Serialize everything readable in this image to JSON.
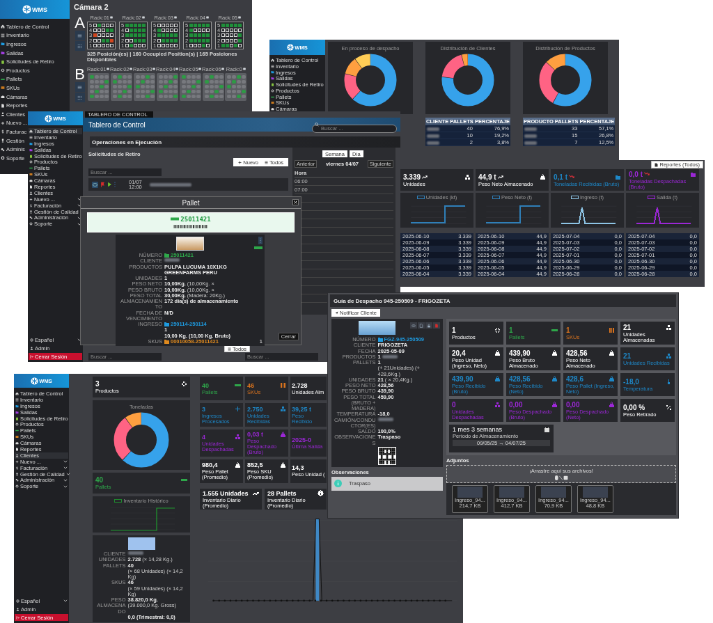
{
  "camera_window": {
    "sidebar": {
      "logo": "WMS",
      "items": [
        {
          "label": "Tablero de Control",
          "kind": "home",
          "selected": false
        },
        {
          "label": "Inventario",
          "kind": "list",
          "selected": false
        },
        {
          "label": "Ingresos",
          "kind": "inbox",
          "selected": false
        },
        {
          "label": "Salidas",
          "kind": "outbox",
          "selected": false
        },
        {
          "label": "Solicitudes de Retiro",
          "kind": "clipboard",
          "selected": false
        },
        {
          "label": "Productos",
          "kind": "gear",
          "selected": false
        },
        {
          "label": "Pallets",
          "kind": "pallet",
          "selected": false
        },
        {
          "label": "SKUs",
          "kind": "box",
          "selected": false
        },
        {
          "label": "Cámaras",
          "kind": "building",
          "selected": false
        },
        {
          "label": "Reportes",
          "kind": "doc",
          "selected": false
        },
        {
          "label": "Clientes",
          "kind": "person",
          "selected": false
        },
        {
          "label": "Nuevo ...",
          "kind": "plus",
          "selected": false
        },
        {
          "label": "Facturac",
          "kind": "dollar",
          "selected": false
        },
        {
          "label": "Gestión",
          "kind": "trophy",
          "selected": false
        },
        {
          "label": "Adminis",
          "kind": "gears",
          "selected": false
        },
        {
          "label": "Soporte",
          "kind": "help",
          "selected": false
        }
      ]
    },
    "title": "Cámara 2",
    "sections": [
      {
        "letter": "A",
        "racks": [
          {
            "label": "Rack:01",
            "rows": [
              {
                "number": "5",
                "cells": [
                  {
                    "kind": "free"
                  },
                  {
                    "kind": "full"
                  },
                  {
                    "kind": "free"
                  },
                  {
                    "kind": "free"
                  },
                  {
                    "kind": "free"
                  }
                ]
              },
              {
                "number": "4",
                "cells": [
                  {
                    "kind": "free"
                  },
                  {
                    "kind": "free"
                  },
                  {
                    "kind": "free"
                  },
                  {
                    "kind": "full"
                  },
                  {
                    "kind": "full"
                  }
                ]
              },
              {
                "number": "3",
                "cells": [
                  {
                    "kind": "alert"
                  },
                  {
                    "kind": "free"
                  },
                  {
                    "kind": "free"
                  },
                  {
                    "kind": "free"
                  },
                  {
                    "kind": "free"
                  }
                ]
              },
              {
                "number": "2",
                "cells": [
                  {
                    "kind": "free"
                  },
                  {
                    "kind": "free"
                  },
                  {
                    "kind": "full"
                  },
                  {
                    "kind": "full"
                  },
                  {
                    "kind": "alert"
                  }
                ]
              },
              {
                "number": "1",
                "cells": [
                  {
                    "kind": "free"
                  },
                  {
                    "kind": "free"
                  },
                  {
                    "kind": "free"
                  },
                  {
                    "kind": "free"
                  },
                  {
                    "kind": "free"
                  }
                ]
              }
            ]
          },
          {
            "label": "Rack:02",
            "rows": [
              {
                "number": "5",
                "cells": [
                  {
                    "kind": "full"
                  },
                  {
                    "kind": "full"
                  },
                  {
                    "kind": "full"
                  },
                  {
                    "kind": "full"
                  },
                  {
                    "kind": "full"
                  }
                ]
              },
              {
                "number": "4",
                "cells": [
                  {
                    "kind": "free"
                  },
                  {
                    "kind": "full"
                  },
                  {
                    "kind": "full"
                  },
                  {
                    "kind": "full"
                  },
                  {
                    "kind": "full"
                  }
                ]
              },
              {
                "number": "3",
                "cells": [
                  {
                    "kind": "full"
                  },
                  {
                    "kind": "full"
                  },
                  {
                    "kind": "full"
                  },
                  {
                    "kind": "full"
                  },
                  {
                    "kind": "full"
                  }
                ]
              },
              {
                "number": "2",
                "cells": [
                  {
                    "kind": "free"
                  },
                  {
                    "kind": "free"
                  },
                  {
                    "kind": "full"
                  },
                  {
                    "kind": "full"
                  },
                  {
                    "kind": "full"
                  }
                ]
              },
              {
                "number": "1",
                "cells": [
                  {
                    "kind": "free"
                  },
                  {
                    "kind": "full"
                  },
                  {
                    "kind": "free"
                  },
                  {
                    "kind": "free"
                  },
                  {
                    "kind": "free"
                  }
                ]
              }
            ]
          },
          {
            "label": "Rack:03",
            "rows": [
              {
                "number": "5",
                "cells": [
                  {
                    "kind": "free"
                  },
                  {
                    "kind": "free"
                  },
                  {
                    "kind": "free"
                  },
                  {
                    "kind": "free"
                  },
                  {
                    "kind": "free"
                  }
                ]
              },
              {
                "number": "4",
                "cells": [
                  {
                    "kind": "full"
                  },
                  {
                    "kind": "free"
                  },
                  {
                    "kind": "free"
                  },
                  {
                    "kind": "free"
                  },
                  {
                    "kind": "free"
                  }
                ]
              },
              {
                "number": "3",
                "cells": [
                  {
                    "kind": "full"
                  },
                  {
                    "kind": "full"
                  },
                  {
                    "kind": "full"
                  },
                  {
                    "kind": "full"
                  },
                  {
                    "kind": "full"
                  }
                ]
              },
              {
                "number": "2",
                "cells": [
                  {
                    "kind": "free"
                  },
                  {
                    "kind": "full"
                  },
                  {
                    "kind": "full"
                  },
                  {
                    "kind": "full"
                  },
                  {
                    "kind": "full"
                  }
                ]
              },
              {
                "number": "1",
                "cells": [
                  {
                    "kind": "free"
                  },
                  {
                    "kind": "free"
                  },
                  {
                    "kind": "free"
                  },
                  {
                    "kind": "free"
                  },
                  {
                    "kind": "free"
                  }
                ]
              }
            ]
          },
          {
            "label": "Rack:04",
            "rows": [
              {
                "number": "5",
                "cells": [
                  {
                    "kind": "full"
                  },
                  {
                    "kind": "full"
                  },
                  {
                    "kind": "full"
                  },
                  {
                    "kind": "full"
                  },
                  {
                    "kind": "full"
                  }
                ]
              },
              {
                "number": "4",
                "cells": [
                  {
                    "kind": "full"
                  },
                  {
                    "kind": "free"
                  },
                  {
                    "kind": "free"
                  },
                  {
                    "kind": "free"
                  },
                  {
                    "kind": "free"
                  }
                ]
              },
              {
                "number": "3",
                "cells": [
                  {
                    "kind": "full"
                  },
                  {
                    "kind": "full"
                  },
                  {
                    "kind": "full"
                  },
                  {
                    "kind": "full"
                  },
                  {
                    "kind": "full"
                  }
                ]
              },
              {
                "number": "2",
                "cells": [
                  {
                    "kind": "full"
                  },
                  {
                    "kind": "full"
                  },
                  {
                    "kind": "full"
                  },
                  {
                    "kind": "full"
                  },
                  {
                    "kind": "full"
                  }
                ]
              },
              {
                "number": "1",
                "cells": [
                  {
                    "kind": "free"
                  },
                  {
                    "kind": "free"
                  },
                  {
                    "kind": "free"
                  },
                  {
                    "kind": "full"
                  },
                  {
                    "kind": "free"
                  }
                ]
              }
            ]
          },
          {
            "label": "Rack:05",
            "rows": [
              {
                "number": "5",
                "cells": [
                  {
                    "kind": "full"
                  },
                  {
                    "kind": "full"
                  },
                  {
                    "kind": "full"
                  },
                  {
                    "kind": "full"
                  },
                  {
                    "kind": "full"
                  }
                ]
              },
              {
                "number": "4",
                "cells": [
                  {
                    "kind": "free"
                  },
                  {
                    "kind": "free"
                  },
                  {
                    "kind": "free"
                  },
                  {
                    "kind": "free"
                  },
                  {
                    "kind": "free"
                  }
                ]
              },
              {
                "number": "3",
                "cells": [
                  {
                    "kind": "free"
                  },
                  {
                    "kind": "free"
                  },
                  {
                    "kind": "free"
                  },
                  {
                    "kind": "free"
                  },
                  {
                    "kind": "full"
                  }
                ]
              },
              {
                "number": "2",
                "cells": [
                  {
                    "kind": "free"
                  },
                  {
                    "kind": "free"
                  },
                  {
                    "kind": "free"
                  },
                  {
                    "kind": "free"
                  },
                  {
                    "kind": "full"
                  }
                ]
              },
              {
                "number": "1",
                "cells": [
                  {
                    "kind": "full"
                  },
                  {
                    "kind": "full"
                  },
                  {
                    "kind": "free"
                  },
                  {
                    "kind": "full"
                  },
                  {
                    "kind": "free"
                  }
                ]
              }
            ]
          }
        ],
        "summary": "325 Posición(es) | 160 Occupied Position(s) | 165 Posiciones Disponibles"
      },
      {
        "letter": "B",
        "racks": [
          {
            "label": "Rack:01"
          },
          {
            "label": "Rack:02"
          },
          {
            "label": "Rack:03"
          },
          {
            "label": "Rack:04"
          },
          {
            "label": "Rack:05"
          },
          {
            "label": "Rack:06"
          },
          {
            "label": "Rack:0"
          }
        ]
      }
    ]
  },
  "dashboard_window": {
    "sidebar": {
      "logo": "WMS",
      "items": [
        {
          "label": "Tablero de Control",
          "kind": "home",
          "selected": false
        },
        {
          "label": "Inventario",
          "kind": "list",
          "selected": false
        },
        {
          "label": "Ingresos",
          "kind": "inbox",
          "selected": false
        },
        {
          "label": "Salidas",
          "kind": "outbox",
          "selected": false
        },
        {
          "label": "Solicitudes de Retiro",
          "kind": "clipboard",
          "selected": false
        },
        {
          "label": "Productos",
          "kind": "gear",
          "selected": false
        },
        {
          "label": "Pallets",
          "kind": "pallet",
          "selected": false
        },
        {
          "label": "SKUs",
          "kind": "box",
          "selected": false
        },
        {
          "label": "Cámaras",
          "kind": "building",
          "selected": false
        }
      ]
    },
    "donut_cards": [
      {
        "title": "En proceso de despacho"
      },
      {
        "title": "Distribución de Clientes",
        "table": {
          "columns": [
            "CLIENTE",
            "PALLETS",
            "PERCENTAJE"
          ],
          "rows": [
            {
              "pallets": "40",
              "share": "76,9%"
            },
            {
              "pallets": "10",
              "share": "19,2%"
            },
            {
              "pallets": "2",
              "share": "3,8%"
            }
          ]
        }
      },
      {
        "title": "Distribución de Productos",
        "table": {
          "columns": [
            "PRODUCTO",
            "PALLETS",
            "PERCENTAJE"
          ],
          "rows": [
            {
              "pallets": "33",
              "share": "57,1%"
            },
            {
              "pallets": "15",
              "share": "26,8%"
            },
            {
              "pallets": "7",
              "share": "12,5%"
            }
          ]
        }
      }
    ],
    "reports_button": "Reportes (Todos)",
    "stats": [
      {
        "value": "3.339",
        "rising": true,
        "caption": "Unidades",
        "color": "#ffffff",
        "kind": "boxes"
      },
      {
        "value": "44,9 t",
        "rising": true,
        "caption": "Peso Neto Almacenado",
        "color": "#ffffff",
        "kind": "weight"
      },
      {
        "value": "0,1 t",
        "rising": false,
        "caption": "Toneladas Recibidas (Bruto)",
        "color": "#1e88c8",
        "kind": "inbox"
      },
      {
        "value": "0,0 t",
        "rising": false,
        "caption": "Toneladas Despachadas (Bruto)",
        "color": "#9b27d6",
        "kind": "outbox"
      }
    ],
    "charts": [
      {
        "legend": "Unidades (kt)",
        "kind": "step",
        "color": "#2f7fb8"
      },
      {
        "legend": "Peso Neto (t)",
        "kind": "step",
        "color": "#2f7fb8"
      },
      {
        "legend": "Ingreso (t)",
        "kind": "spike",
        "color": "#8ec5e6"
      },
      {
        "legend": "Salida (t)",
        "kind": "spike",
        "color": "#9b27d6"
      }
    ],
    "history_tables": [
      {
        "rows": [
          {
            "date": "2025-06-10",
            "value": "3.339"
          },
          {
            "date": "2025-06-09",
            "value": "3.339"
          },
          {
            "date": "2025-06-08",
            "value": "3.339"
          },
          {
            "date": "2025-06-07",
            "value": "3.339"
          },
          {
            "date": "2025-06-06",
            "value": "3.339"
          },
          {
            "date": "2025-06-05",
            "value": "3.339"
          },
          {
            "date": "2025-06-04",
            "value": "3.339"
          }
        ]
      },
      {
        "rows": [
          {
            "date": "2025-06-10",
            "value": "44,9"
          },
          {
            "date": "2025-06-09",
            "value": "44,9"
          },
          {
            "date": "2025-06-08",
            "value": "44,9"
          },
          {
            "date": "2025-06-07",
            "value": "44,9"
          },
          {
            "date": "2025-06-06",
            "value": "44,9"
          },
          {
            "date": "2025-06-05",
            "value": "44,9"
          },
          {
            "date": "2025-06-04",
            "value": "44,9"
          }
        ]
      },
      {
        "rows": [
          {
            "date": "2025-07-04",
            "value": "0,0"
          },
          {
            "date": "2025-07-03",
            "value": "0,0"
          },
          {
            "date": "2025-07-02",
            "value": "0,0"
          },
          {
            "date": "2025-07-01",
            "value": "0,0"
          },
          {
            "date": "2025-06-30",
            "value": "0,0"
          },
          {
            "date": "2025-06-29",
            "value": "0,0"
          },
          {
            "date": "2025-06-28",
            "value": "0,0"
          }
        ]
      },
      {
        "rows": [
          {
            "date": "2025-07-04",
            "value": "0,0"
          },
          {
            "date": "2025-07-03",
            "value": "0,0"
          },
          {
            "date": "2025-07-02",
            "value": "0,0"
          },
          {
            "date": "2025-07-01",
            "value": "0,0"
          },
          {
            "date": "2025-06-30",
            "value": "0,0"
          },
          {
            "date": "2025-06-29",
            "value": "0,0"
          },
          {
            "date": "2025-06-28",
            "value": "0,0"
          }
        ]
      }
    ]
  },
  "operations_window": {
    "sidebar": {
      "logo": "WMS",
      "items": [
        {
          "label": "Tablero de Control",
          "kind": "home",
          "selected": true,
          "expandable": false
        },
        {
          "label": "Inventario",
          "kind": "list",
          "selected": false,
          "expandable": false
        },
        {
          "label": "Ingresos",
          "kind": "inbox",
          "selected": false,
          "expandable": false
        },
        {
          "label": "Salidas",
          "kind": "outbox",
          "selected": false,
          "expandable": false
        },
        {
          "label": "Solicitudes de Retiro",
          "kind": "clipboard",
          "selected": false,
          "expandable": false
        },
        {
          "label": "Productos",
          "kind": "gear",
          "selected": false,
          "expandable": false
        },
        {
          "label": "Pallets",
          "kind": "pallet",
          "selected": false,
          "expandable": false
        },
        {
          "label": "SKUs",
          "kind": "box",
          "selected": false,
          "expandable": false
        },
        {
          "label": "Cámaras",
          "kind": "building",
          "selected": false,
          "expandable": false
        },
        {
          "label": "Reportes",
          "kind": "doc",
          "selected": false,
          "expandable": false
        },
        {
          "label": "Clientes",
          "kind": "person",
          "selected": false,
          "expandable": false
        },
        {
          "label": "Nuevo ...",
          "kind": "plus",
          "selected": false,
          "expandable": true
        },
        {
          "label": "Facturación",
          "kind": "dollar",
          "selected": false,
          "expandable": true
        },
        {
          "label": "Gestión de Calidad",
          "kind": "trophy",
          "selected": false,
          "expandable": true
        },
        {
          "label": "Administración",
          "kind": "gears",
          "selected": false,
          "expandable": true
        },
        {
          "label": "Soporte",
          "kind": "help",
          "selected": false,
          "expandable": true
        }
      ],
      "footer": [
        {
          "label": "Español",
          "kind": "globe",
          "selected": false,
          "expandable": true
        },
        {
          "label": "Admin",
          "kind": "user",
          "selected": false,
          "expandable": false
        },
        {
          "label": "Cerrar Sesión",
          "kind": "logout",
          "selected": false,
          "expandable": false
        }
      ]
    },
    "breadcrumb": "TABLERO DE CONTROL",
    "title": "Tablero de Control",
    "search": {
      "placeholder": "Buscar ..."
    },
    "section_title": "Operaciones en Ejecución",
    "panel_title": "Solicitudes de Retiro",
    "new_button": "Nuevo",
    "all_button": "Todos",
    "list_search": {
      "placeholder": "Buscar ..."
    },
    "requests": [
      {
        "date": "01/07",
        "time": "12:00"
      }
    ],
    "calendar": {
      "view_buttons": [
        "Semana",
        "Día"
      ],
      "prev": "Anterior",
      "day": "viernes 04/07",
      "next": "Siguiente",
      "hour_header": "Hora",
      "hours": [
        "06:00",
        "07:00"
      ]
    },
    "bottom_button": "Todos",
    "bottom_searches": [
      {
        "placeholder": "Buscar ..."
      },
      {
        "placeholder": "Buscar ..."
      }
    ],
    "modal": {
      "title": "Pallet",
      "code": "25011421",
      "fields": [
        {
          "label": "NÚMERO",
          "value": "25011421",
          "color": "#2ea84a"
        },
        {
          "label": "CLIENTE",
          "redacted": true
        },
        {
          "label": "PRODUCTOS",
          "value": "PULPA LUCUMA 10X1KG GREENFARMS PERU"
        },
        {
          "label": "UNIDADES",
          "value": "1"
        },
        {
          "label": "PESO NETO",
          "value": "10,00Kg.",
          "note": "(10,00Kg. ×"
        },
        {
          "label": "PESO BRUTO",
          "value": "10,00Kg.",
          "note": "(10,00Kg. ×"
        },
        {
          "label": "PESO TOTAL",
          "value": "30,00Kg.",
          "note": "(Madera: 20Kg.)"
        },
        {
          "label": "ALMACENAMIENTO",
          "value": "172 día(s) de almacenamiento"
        },
        {
          "label": "FECHA DE VENCIMIENTO",
          "value": "N/D"
        },
        {
          "label": "INGRESO",
          "value": "250114-250114",
          "color": "#1e9be0"
        },
        {
          "value": "1"
        },
        {
          "value": "10,00 Kg. (10,00 Kg. Bruto)"
        },
        {
          "label": "SKUS",
          "value": "00010058-25011421",
          "color": "#e08a1e",
          "count": "1"
        }
      ],
      "close_button": "Cerrar"
    }
  },
  "client_window": {
    "sidebar": {
      "logo": "WMS",
      "items": [
        {
          "label": "Tablero de Control",
          "kind": "home",
          "selected": false,
          "expandable": false
        },
        {
          "label": "Inventario",
          "kind": "list",
          "selected": false,
          "expandable": false
        },
        {
          "label": "Ingresos",
          "kind": "inbox",
          "selected": false,
          "expandable": false
        },
        {
          "label": "Salidas",
          "kind": "outbox",
          "selected": false,
          "expandable": false
        },
        {
          "label": "Solicitudes de Retiro",
          "kind": "clipboard",
          "selected": false,
          "expandable": false
        },
        {
          "label": "Productos",
          "kind": "gear",
          "selected": false,
          "expandable": false
        },
        {
          "label": "Pallets",
          "kind": "pallet",
          "selected": false,
          "expandable": false
        },
        {
          "label": "SKUs",
          "kind": "box",
          "selected": false,
          "expandable": false
        },
        {
          "label": "Cámaras",
          "kind": "building",
          "selected": false,
          "expandable": false
        },
        {
          "label": "Reportes",
          "kind": "doc",
          "selected": false,
          "expandable": false
        },
        {
          "label": "Clientes",
          "kind": "person",
          "selected": true,
          "expandable": false
        },
        {
          "label": "Nuevo ...",
          "kind": "plus",
          "selected": false,
          "expandable": true
        },
        {
          "label": "Facturación",
          "kind": "dollar",
          "selected": false,
          "expandable": true
        },
        {
          "label": "Gestión de Calidad",
          "kind": "trophy",
          "selected": false,
          "expandable": true
        },
        {
          "label": "Administración",
          "kind": "gears",
          "selected": false,
          "expandable": true
        },
        {
          "label": "Soporte",
          "kind": "help",
          "selected": false,
          "expandable": true
        }
      ],
      "footer": [
        {
          "label": "Español",
          "kind": "globe",
          "selected": false,
          "expandable": true
        },
        {
          "label": "Admin",
          "kind": "user",
          "selected": false,
          "expandable": false
        },
        {
          "label": "Cerrar Sesión",
          "kind": "logout",
          "selected": false,
          "expandable": false
        }
      ]
    },
    "products_card": {
      "value": "3",
      "caption": "Productos",
      "color": "#ffffff",
      "kind": "gear"
    },
    "donut_title": "Toneladas",
    "pallets_card": {
      "value": "40",
      "caption": "Pallets",
      "color": "#2ea84a",
      "kind": "pallet"
    },
    "history_legend": "Inventario Histórico",
    "client_fields": [
      {
        "label": "CLIENTE",
        "redacted": true
      },
      {
        "label": "UNIDADES",
        "value": "2.728",
        "note": "(× 14,28 Kg.)"
      },
      {
        "label": "PALLETS",
        "value": "40",
        "note": "(× 68 Unidades) (× 14,2 Kg)"
      },
      {
        "label": "SKUS",
        "value": "46",
        "note": "(× 59 Unidades) (× 14,2 Kg)"
      },
      {
        "label": "PESO ALMACENADO",
        "value": "38.820,0 Kg.",
        "note": "(39.000,0 Kg. Gross)"
      },
      {
        "value": "0,0 (Trimestral: 0,0)"
      }
    ],
    "stats": [
      {
        "value": "40",
        "caption": "Pallets",
        "color": "#2ea84a",
        "kind": "pallet"
      },
      {
        "value": "46",
        "caption": "SKUs",
        "color": "#d9731e",
        "kind": "bars"
      },
      {
        "value": "2.728",
        "caption": "Unidades Alm",
        "color": "#ffffff"
      },
      {
        "value": "3",
        "caption": "Ingresos Procesados",
        "color": "#1e88c8",
        "kind": "plus"
      },
      {
        "value": "2.750",
        "caption": "Unidades Recibidas",
        "color": "#1e88c8",
        "kind": "boxes"
      },
      {
        "value": "39,25 t",
        "caption": "Peso Recibido",
        "color": "#1e88c8"
      },
      {
        "value": "4",
        "caption": "Unidades Despachadas",
        "color": "#9b27d6",
        "kind": "boxes"
      },
      {
        "value": "0,03 t",
        "caption": "Peso Despachado (Bruto)",
        "color": "#9b27d6",
        "kind": "weight"
      },
      {
        "value": "2025-0",
        "caption": "Última Salida",
        "color": "#9b27d6"
      },
      {
        "value": "980,4",
        "caption": "Peso Pallet (Promedio)",
        "color": "#ffffff",
        "kind": "weight"
      },
      {
        "value": "852,5",
        "caption": "Peso SKU (Promedio)",
        "color": "#ffffff",
        "kind": "weight"
      },
      {
        "value": "14,3",
        "caption": "Peso Unidad (",
        "color": "#ffffff"
      }
    ],
    "daily_cards": [
      {
        "value": "1.555 Unidades",
        "caption": "Inventario Diario (Promedio)",
        "color": "#ffffff",
        "kind": "trend"
      },
      {
        "value": "28 Pallets",
        "caption": "Inventario Diario (Promedio)",
        "color": "#ffffff",
        "kind": "info"
      }
    ]
  },
  "guide_window": {
    "title": "Guía de Despacho 945-250509 - FRIGOZETA",
    "notify_button": "Notificar Cliente",
    "fields": [
      {
        "label": "NÚMERO",
        "value": "FGZ-945-250509",
        "color": "#1e9be0"
      },
      {
        "label": "CLIENTE",
        "value": "FRIGOZETA"
      },
      {
        "label": "FECHA",
        "value": "2025-05-09"
      },
      {
        "label": "PRODUCTOS",
        "value": "1",
        "redacted": true
      },
      {
        "label": "PALLETS",
        "value": "1",
        "note": "(+ 21Unidades) (+ 428,6Kg.)"
      },
      {
        "label": "UNIDADES",
        "value": "21",
        "note": "( × 20,4Kg.)"
      },
      {
        "label": "PESO NETO",
        "value": "428,56"
      },
      {
        "label": "PESO BRUTO",
        "value": "439,90"
      },
      {
        "label": "PESO TOTAL (BRUTO + MADERA)",
        "value": "459,90"
      },
      {
        "label": "TEMPERATURA",
        "value": "-18,0"
      },
      {
        "label": "CAMIÓN/CONDUCTOR(ES)",
        "redacted": true
      },
      {
        "label": "SALDO",
        "value": "100,0%"
      },
      {
        "label": "OBSERVACIONES",
        "value": "Traspaso"
      }
    ],
    "observations_title": "Observaciones",
    "observations": [
      {
        "text": "Traspaso"
      }
    ],
    "stats": [
      {
        "value": "1",
        "caption": "Productos",
        "color": "#ffffff",
        "kind": "gear"
      },
      {
        "value": "1",
        "caption": "Pallets",
        "color": "#2ea84a",
        "kind": "pallet"
      },
      {
        "value": "1",
        "caption": "SKUs",
        "color": "#d9731e",
        "kind": "bars"
      },
      {
        "value": "21",
        "caption": "Unidades Almacenadas",
        "color": "#ffffff",
        "kind": "boxes"
      },
      {
        "value": "20,4",
        "caption": "Peso Unidad (Ingreso, Neto)",
        "color": "#ffffff",
        "kind": "weight"
      },
      {
        "value": "439,90",
        "caption": "Peso Bruto Almacenado",
        "color": "#ffffff",
        "kind": "weight"
      },
      {
        "value": "428,56",
        "caption": "Peso Neto Almacenado",
        "color": "#ffffff",
        "kind": "weight"
      },
      {
        "value": "21",
        "caption": "Unidades Recibidas",
        "color": "#1e88c8",
        "kind": "boxes"
      },
      {
        "value": "439,90",
        "caption": "Peso Recibido (Bruto)",
        "color": "#1e88c8",
        "kind": "weight"
      },
      {
        "value": "428,56",
        "caption": "Peso Recibido (Neto)",
        "color": "#1e88c8",
        "kind": "weight"
      },
      {
        "value": "428,6",
        "caption": "Peso Pallet (Ingreso, Neto)",
        "color": "#1e88c8",
        "kind": "weight"
      },
      {
        "value": "-18,0",
        "caption": "Temperatura",
        "color": "#1e88c8",
        "kind": "thermo"
      },
      {
        "value": "0",
        "caption": "Unidades Despachadas",
        "color": "#9b27d6",
        "kind": "boxes"
      },
      {
        "value": "0,00",
        "caption": "Peso Despachado (Bruto)",
        "color": "#9b27d6",
        "kind": "weight"
      },
      {
        "value": "0,00",
        "caption": "Peso Despachado (Neto)",
        "color": "#9b27d6",
        "kind": "weight"
      },
      {
        "value": "0,00 %",
        "caption": "Peso Retirado",
        "color": "#ffffff",
        "kind": "percent"
      }
    ],
    "period": {
      "value": "1 mes 3 semanas",
      "caption": "Período de Almacenamiento",
      "range": "09/05/25 → 04/07/25"
    },
    "attachments_title": "Adjuntos",
    "dropzone": "¡Arrastre aquí sus archivos!",
    "files": [
      {
        "name": "Ingreso_94...",
        "size": "214,7 KB"
      },
      {
        "name": "Ingreso_94...",
        "size": "412,7 KB"
      },
      {
        "name": "Ingreso_94...",
        "size": "70,9 KB"
      },
      {
        "name": "Ingreso_94...",
        "size": "48,8 KB"
      }
    ]
  }
}
